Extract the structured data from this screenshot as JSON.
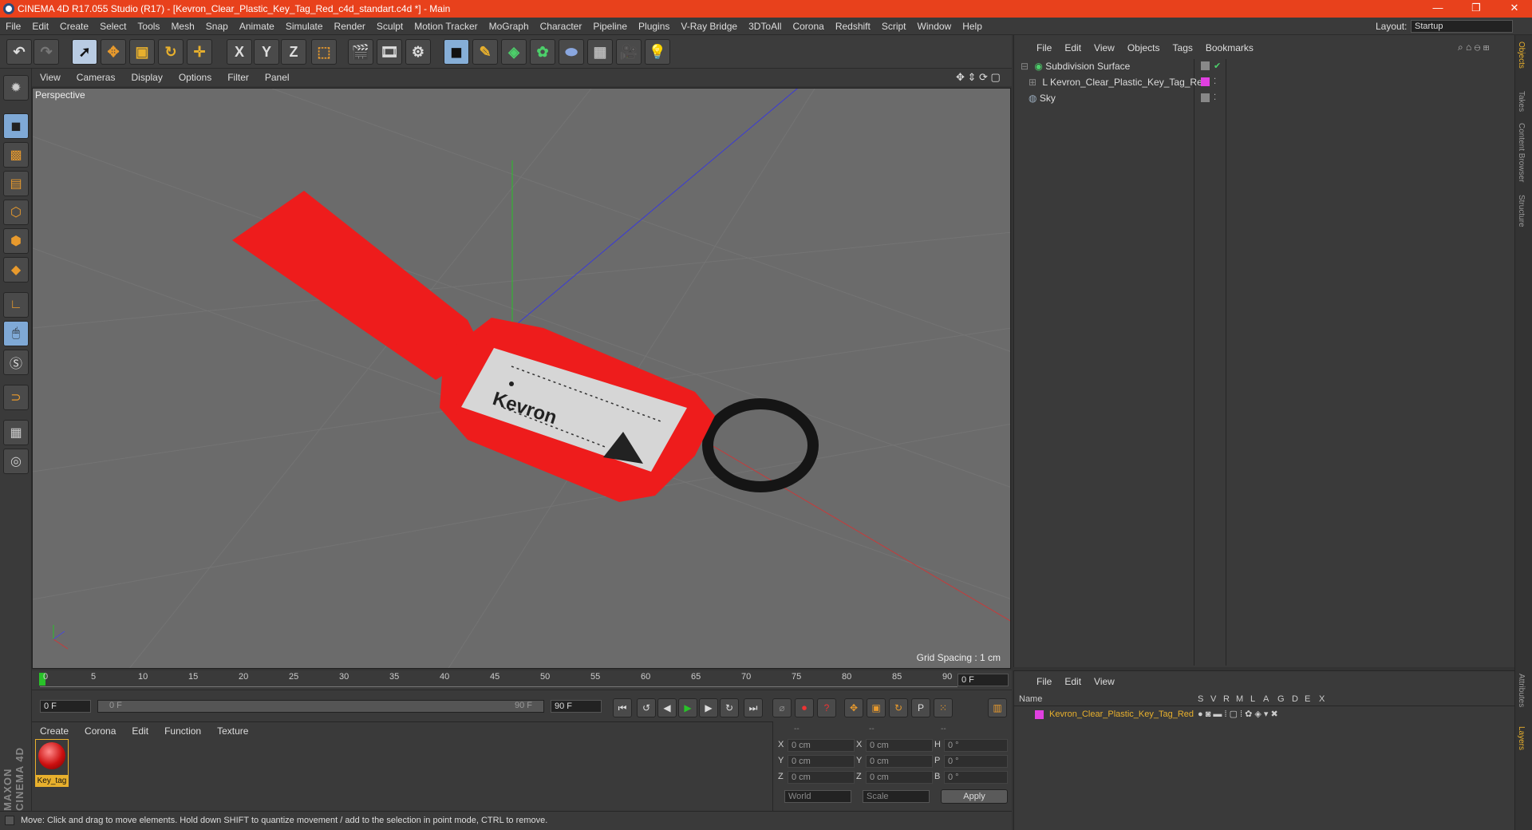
{
  "titlebar": {
    "title": "CINEMA 4D R17.055 Studio (R17) - [Kevron_Clear_Plastic_Key_Tag_Red_c4d_standart.c4d *] - Main",
    "minimize": "—",
    "maximize": "❐",
    "close": "✕",
    "accent": "#e8411c"
  },
  "menubar": {
    "items": [
      "File",
      "Edit",
      "Create",
      "Select",
      "Tools",
      "Mesh",
      "Snap",
      "Animate",
      "Simulate",
      "Render",
      "Sculpt",
      "Motion Tracker",
      "MoGraph",
      "Character",
      "Pipeline",
      "Plugins",
      "V-Ray Bridge",
      "3DToAll",
      "Corona",
      "Redshift",
      "Script",
      "Window",
      "Help"
    ],
    "layout_label": "Layout:",
    "layout_value": "Startup"
  },
  "toolbar": {
    "axis_x": "X",
    "axis_y": "Y",
    "axis_z": "Z"
  },
  "viewport": {
    "menu": [
      "View",
      "Cameras",
      "Display",
      "Options",
      "Filter",
      "Panel"
    ],
    "camera_label": "Perspective",
    "grid_spacing": "Grid Spacing : 1 cm",
    "object_color": "#ee1c1c",
    "label_text": "Kevron"
  },
  "timeline": {
    "ticks": [
      "0",
      "5",
      "10",
      "15",
      "20",
      "25",
      "30",
      "35",
      "40",
      "45",
      "50",
      "55",
      "60",
      "65",
      "70",
      "75",
      "80",
      "85",
      "90"
    ],
    "current_frame": "0 F",
    "start_field": "0 F",
    "range_start": "0 F",
    "range_end": "90 F",
    "end_field": "90 F"
  },
  "material_manager": {
    "menu": [
      "Create",
      "Corona",
      "Edit",
      "Function",
      "Texture"
    ],
    "material_name": "Key_tag",
    "brand": "MAXON CINEMA 4D"
  },
  "coordinates": {
    "header": [
      "--",
      "--",
      "--"
    ],
    "rows": [
      {
        "a": "X",
        "av": "0 cm",
        "b": "X",
        "bv": "0 cm",
        "c": "H",
        "cv": "0 °"
      },
      {
        "a": "Y",
        "av": "0 cm",
        "b": "Y",
        "bv": "0 cm",
        "c": "P",
        "cv": "0 °"
      },
      {
        "a": "Z",
        "av": "0 cm",
        "b": "Z",
        "bv": "0 cm",
        "c": "B",
        "cv": "0 °"
      }
    ],
    "mode_world": "World",
    "mode_scale": "Scale",
    "apply_label": "Apply"
  },
  "status": {
    "text": "Move: Click and drag to move elements. Hold down SHIFT to quantize movement / add to the selection in point mode, CTRL to remove."
  },
  "object_manager": {
    "menu": [
      "File",
      "Edit",
      "View",
      "Objects",
      "Tags",
      "Bookmarks"
    ],
    "objects": [
      {
        "name": "Subdivision Surface"
      },
      {
        "name": "Kevron_Clear_Plastic_Key_Tag_Red"
      },
      {
        "name": "Sky"
      }
    ]
  },
  "layer_manager": {
    "menu": [
      "File",
      "Edit",
      "View"
    ],
    "columns": [
      "Name",
      "S",
      "V",
      "R",
      "M",
      "L",
      "A",
      "G",
      "D",
      "E",
      "X"
    ],
    "layer_name": "Kevron_Clear_Plastic_Key_Tag_Red",
    "layer_color": "#e040e0"
  },
  "right_tabs": [
    "Objects",
    "Takes",
    "Content Browser",
    "Structure"
  ],
  "right_tabs_bottom": [
    "Attributes",
    "Layers"
  ]
}
